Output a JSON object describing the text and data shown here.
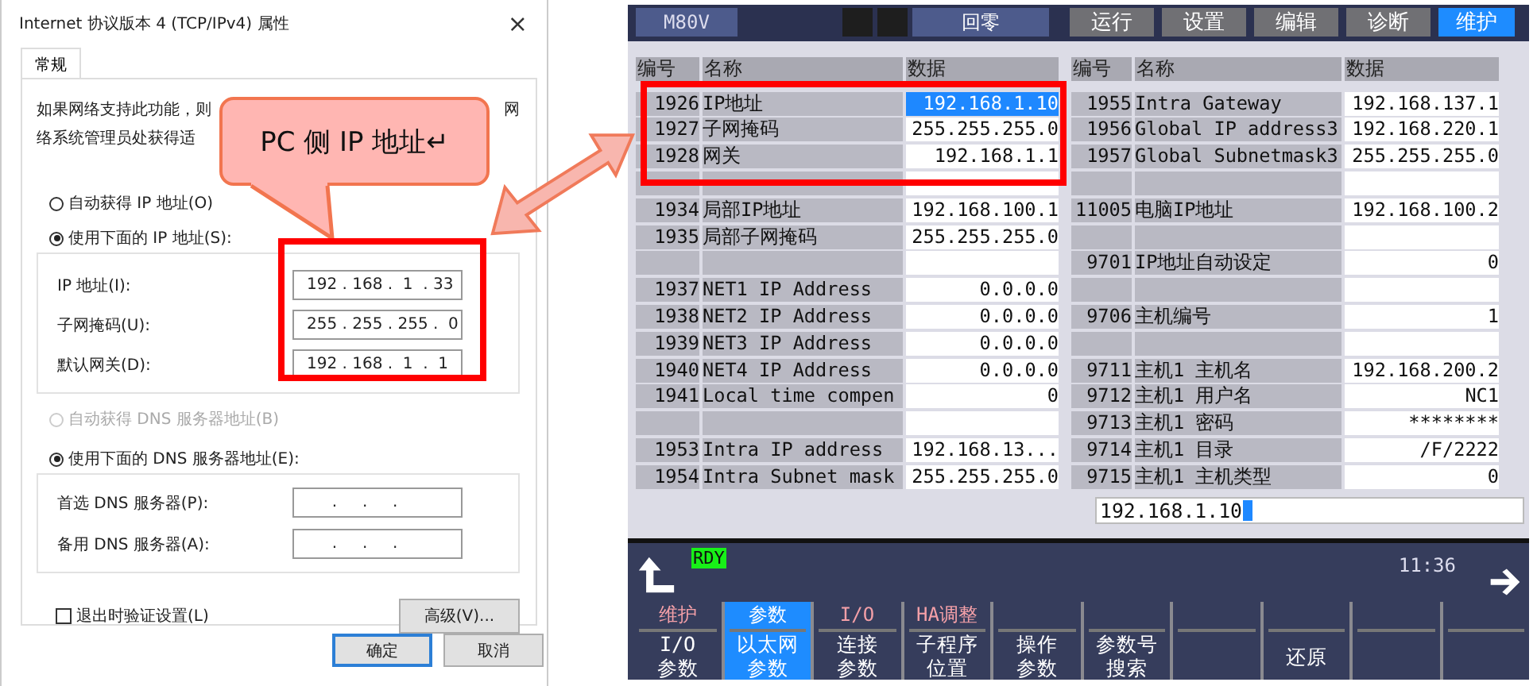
{
  "dialog": {
    "title": "Internet 协议版本 4 (TCP/IPv4) 属性",
    "close": "×",
    "tabs": [
      {
        "label": "常规",
        "selected": true
      }
    ],
    "intro": [
      {
        "text": "如果网络支持此功能，则",
        "kind": "left"
      },
      {
        "text": "网",
        "kind": "right"
      },
      {
        "text": "络系统管理员处获得适",
        "kind": "left"
      }
    ],
    "ip_options": [
      {
        "label": "自动获得 IP 地址(O)",
        "selected": false,
        "disabled": false
      },
      {
        "label": "使用下面的 IP 地址(S):",
        "selected": true,
        "disabled": false
      }
    ],
    "ip_fields": [
      {
        "label": "IP 地址(I):",
        "value": "192 . 168 .  1  . 33"
      },
      {
        "label": "子网掩码(U):",
        "value": "255 . 255 . 255 .  0"
      },
      {
        "label": "默认网关(D):",
        "value": "192 . 168 .  1  .  1"
      }
    ],
    "dns_options": [
      {
        "label": "自动获得 DNS 服务器地址(B)",
        "selected": false,
        "disabled": true
      },
      {
        "label": "使用下面的 DNS 服务器地址(E):",
        "selected": true,
        "disabled": false
      }
    ],
    "dns_fields": [
      {
        "label": "首选 DNS 服务器(P):",
        "value": "     .     .     ."
      },
      {
        "label": "备用 DNS 服务器(A):",
        "value": "     .     .     ."
      }
    ],
    "validate": {
      "label": "退出时验证设置(L)",
      "checked": false
    },
    "advanced": "高级(V)...",
    "buttons": [
      {
        "label": "确定",
        "default": true
      },
      {
        "label": "取消",
        "default": false
      }
    ]
  },
  "callout": {
    "text": "PC 侧 IP 地址↵"
  },
  "cnc": {
    "model": "M80V",
    "mode": "回零",
    "tabs": [
      {
        "label": "运行",
        "selected": false
      },
      {
        "label": "设置",
        "selected": false
      },
      {
        "label": "编辑",
        "selected": false
      },
      {
        "label": "诊断",
        "selected": false
      },
      {
        "label": "维护",
        "selected": true
      }
    ],
    "left_headers": [
      "编号",
      "名称",
      "数据"
    ],
    "right_headers": [
      "编号",
      "名称",
      "数据"
    ],
    "left_rows": [
      {
        "kind": "param",
        "no": "1926",
        "name": "IP地址",
        "value": "192.168.1.10",
        "selected": true
      },
      {
        "kind": "param",
        "no": "1927",
        "name": "子网掩码",
        "value": "255.255.255.0",
        "selected": false
      },
      {
        "kind": "param",
        "no": "1928",
        "name": "网关",
        "value": "192.168.1.1",
        "selected": false
      },
      {
        "kind": "blank",
        "selected": false
      },
      {
        "kind": "param",
        "no": "1934",
        "name": "局部IP地址",
        "value": "192.168.100.1",
        "selected": false
      },
      {
        "kind": "param",
        "no": "1935",
        "name": "局部子网掩码",
        "value": "255.255.255.0",
        "selected": false
      },
      {
        "kind": "blank",
        "selected": false
      },
      {
        "kind": "param",
        "no": "1937",
        "name": "NET1 IP Address",
        "value": "0.0.0.0",
        "selected": false
      },
      {
        "kind": "param",
        "no": "1938",
        "name": "NET2 IP Address",
        "value": "0.0.0.0",
        "selected": false
      },
      {
        "kind": "param",
        "no": "1939",
        "name": "NET3 IP Address",
        "value": "0.0.0.0",
        "selected": false
      },
      {
        "kind": "param",
        "no": "1940",
        "name": "NET4 IP Address",
        "value": "0.0.0.0",
        "selected": false
      },
      {
        "kind": "param",
        "no": "1941",
        "name": "Local time compen",
        "value": "0",
        "selected": false
      },
      {
        "kind": "blank",
        "selected": false
      },
      {
        "kind": "param",
        "no": "1953",
        "name": "Intra IP address",
        "value": "192.168.13...",
        "selected": false
      },
      {
        "kind": "param",
        "no": "1954",
        "name": "Intra Subnet mask",
        "value": "255.255.255.0",
        "selected": false
      }
    ],
    "right_rows": [
      {
        "kind": "param",
        "no": "1955",
        "name": "Intra Gateway",
        "value": "192.168.137.1",
        "selected": false
      },
      {
        "kind": "param",
        "no": "1956",
        "name": "Global IP address3",
        "value": "192.168.220.1",
        "selected": false
      },
      {
        "kind": "param",
        "no": "1957",
        "name": "Global Subnetmask3",
        "value": "255.255.255.0",
        "selected": false
      },
      {
        "kind": "blank",
        "selected": false
      },
      {
        "kind": "param",
        "no": "11005",
        "name": "电脑IP地址",
        "value": "192.168.100.2",
        "selected": false
      },
      {
        "kind": "blank",
        "selected": false
      },
      {
        "kind": "param",
        "no": "9701",
        "name": "IP地址自动设定",
        "value": "0",
        "selected": false
      },
      {
        "kind": "blank",
        "selected": false
      },
      {
        "kind": "param",
        "no": "9706",
        "name": "主机编号",
        "value": "1",
        "selected": false
      },
      {
        "kind": "blank",
        "selected": false
      },
      {
        "kind": "param",
        "no": "9711",
        "name": "主机1 主机名",
        "value": "192.168.200.2",
        "selected": false
      },
      {
        "kind": "param",
        "no": "9712",
        "name": "主机1 用户名",
        "value": "NC1",
        "selected": false
      },
      {
        "kind": "param",
        "no": "9713",
        "name": "主机1 密码",
        "value": "********",
        "selected": false
      },
      {
        "kind": "param",
        "no": "9714",
        "name": "主机1 目录",
        "value": "/F/2222",
        "selected": false
      },
      {
        "kind": "param",
        "no": "9715",
        "name": "主机1 主机类型",
        "value": "0",
        "selected": false
      }
    ],
    "input": "192.168.1.10",
    "status": "RDY",
    "time": "11:36",
    "softkeys": [
      {
        "top": "维护",
        "lines": [
          "I/O",
          "参数"
        ],
        "selected": false
      },
      {
        "top": "参数",
        "lines": [
          "以太网",
          "参数"
        ],
        "selected": true
      },
      {
        "top": "I/O",
        "lines": [
          "连接",
          "参数"
        ],
        "selected": false
      },
      {
        "top": "HA调整",
        "lines": [
          "子程序",
          "位置"
        ],
        "selected": false
      },
      {
        "lines": [
          "操作",
          "参数"
        ],
        "selected": false
      },
      {
        "lines": [
          "参数号",
          "搜索"
        ],
        "selected": false
      },
      {
        "selected": false
      },
      {
        "lines": [
          "还原"
        ],
        "selected": false
      },
      {
        "selected": false
      },
      {
        "selected": false
      }
    ]
  }
}
